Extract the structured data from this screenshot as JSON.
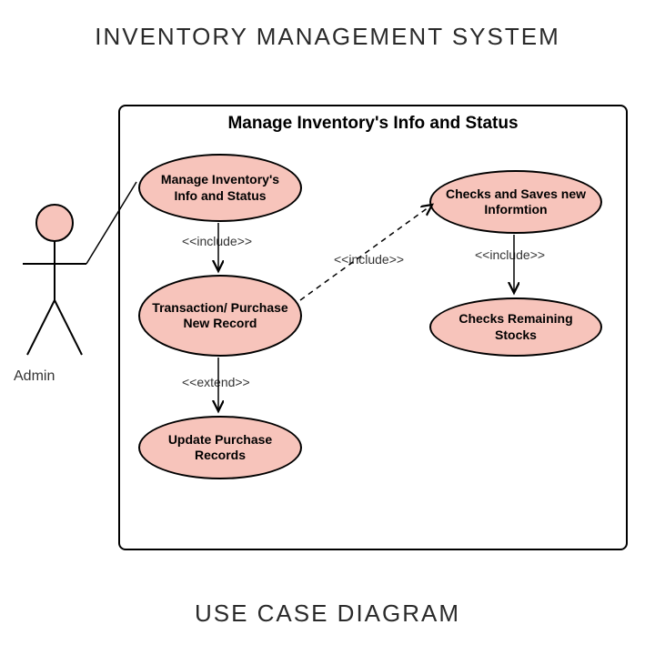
{
  "title": "INVENTORY MANAGEMENT SYSTEM",
  "footer": "USE CASE DIAGRAM",
  "actor": {
    "name": "Admin"
  },
  "system": {
    "title": "Manage Inventory's Info and Status"
  },
  "usecases": {
    "uc1": "Manage Inventory's Info and Status",
    "uc2": "Transaction/ Purchase New Record",
    "uc3": "Update Purchase Records",
    "uc4": "Checks and Saves new Informtion",
    "uc5": "Checks Remaining Stocks"
  },
  "relations": {
    "r1": "<<include>>",
    "r2": "<<include>>",
    "r3": "<<extend>>",
    "r4": "<<include>>"
  }
}
